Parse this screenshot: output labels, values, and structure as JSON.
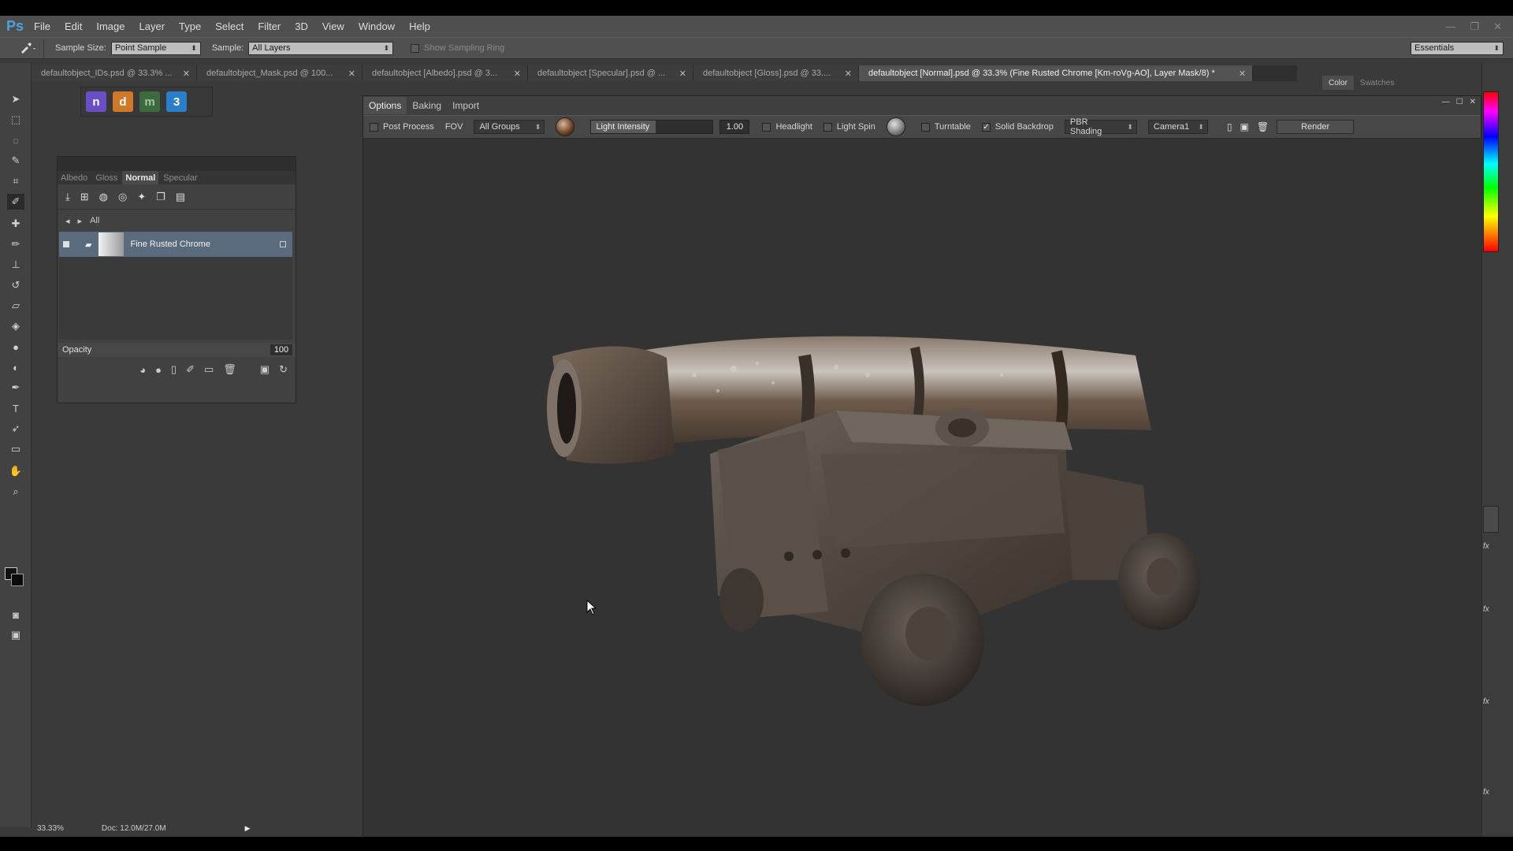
{
  "menu": [
    "File",
    "Edit",
    "Image",
    "Layer",
    "Type",
    "Select",
    "Filter",
    "3D",
    "View",
    "Window",
    "Help"
  ],
  "app_logo": "Ps",
  "options_bar": {
    "sample_size_label": "Sample Size:",
    "sample_size_value": "Point Sample",
    "sample_label": "Sample:",
    "sample_value": "All Layers",
    "show_ring_label": "Show Sampling Ring",
    "workspace": "Essentials"
  },
  "doc_tabs": [
    {
      "title": "defaultobject_IDs.psd @ 33.3% ...",
      "active": false
    },
    {
      "title": "defaultobject_Mask.psd @ 100...",
      "active": false
    },
    {
      "title": "defaultobject [Albedo].psd @ 3...",
      "active": false
    },
    {
      "title": "defaultobject [Specular].psd @ ...",
      "active": false
    },
    {
      "title": "defaultobject [Gloss].psd @ 33....",
      "active": false
    },
    {
      "title": "defaultobject [Normal].psd @ 33.3% (Fine Rusted Chrome [Km-roVg-AO], Layer Mask/8) *",
      "active": true
    }
  ],
  "layers_panel": {
    "tabs": [
      "Albedo",
      "Gloss",
      "Normal",
      "Specular"
    ],
    "active_tab": "Normal",
    "breadcrumb": "All",
    "layer_name": "Fine Rusted Chrome",
    "opacity_label": "Opacity",
    "opacity_value": "100"
  },
  "viewport_panel": {
    "tabs": [
      "Options",
      "Baking",
      "Import"
    ],
    "active_tab": "Options",
    "post_process": "Post Process",
    "fov": "FOV",
    "groups": "All Groups",
    "light_intensity_label": "Light Intensity",
    "light_intensity_value": "1.00",
    "headlight": "Headlight",
    "light_spin": "Light Spin",
    "turntable": "Turntable",
    "solid_backdrop": "Solid Backdrop",
    "solid_backdrop_checked": true,
    "shading": "PBR Shading",
    "camera": "Camera1",
    "render": "Render"
  },
  "right_panel": {
    "tabs": [
      "Color",
      "Swatches"
    ],
    "active_tab": "Color"
  },
  "status": {
    "zoom": "33.33%",
    "doc_size": "Doc: 12.0M/27.0M"
  },
  "colors": {
    "plugin_1": "#6a4fc4",
    "plugin_2": "#d0782a",
    "plugin_3": "#3d6b3f",
    "plugin_4": "#2b7fc9"
  }
}
